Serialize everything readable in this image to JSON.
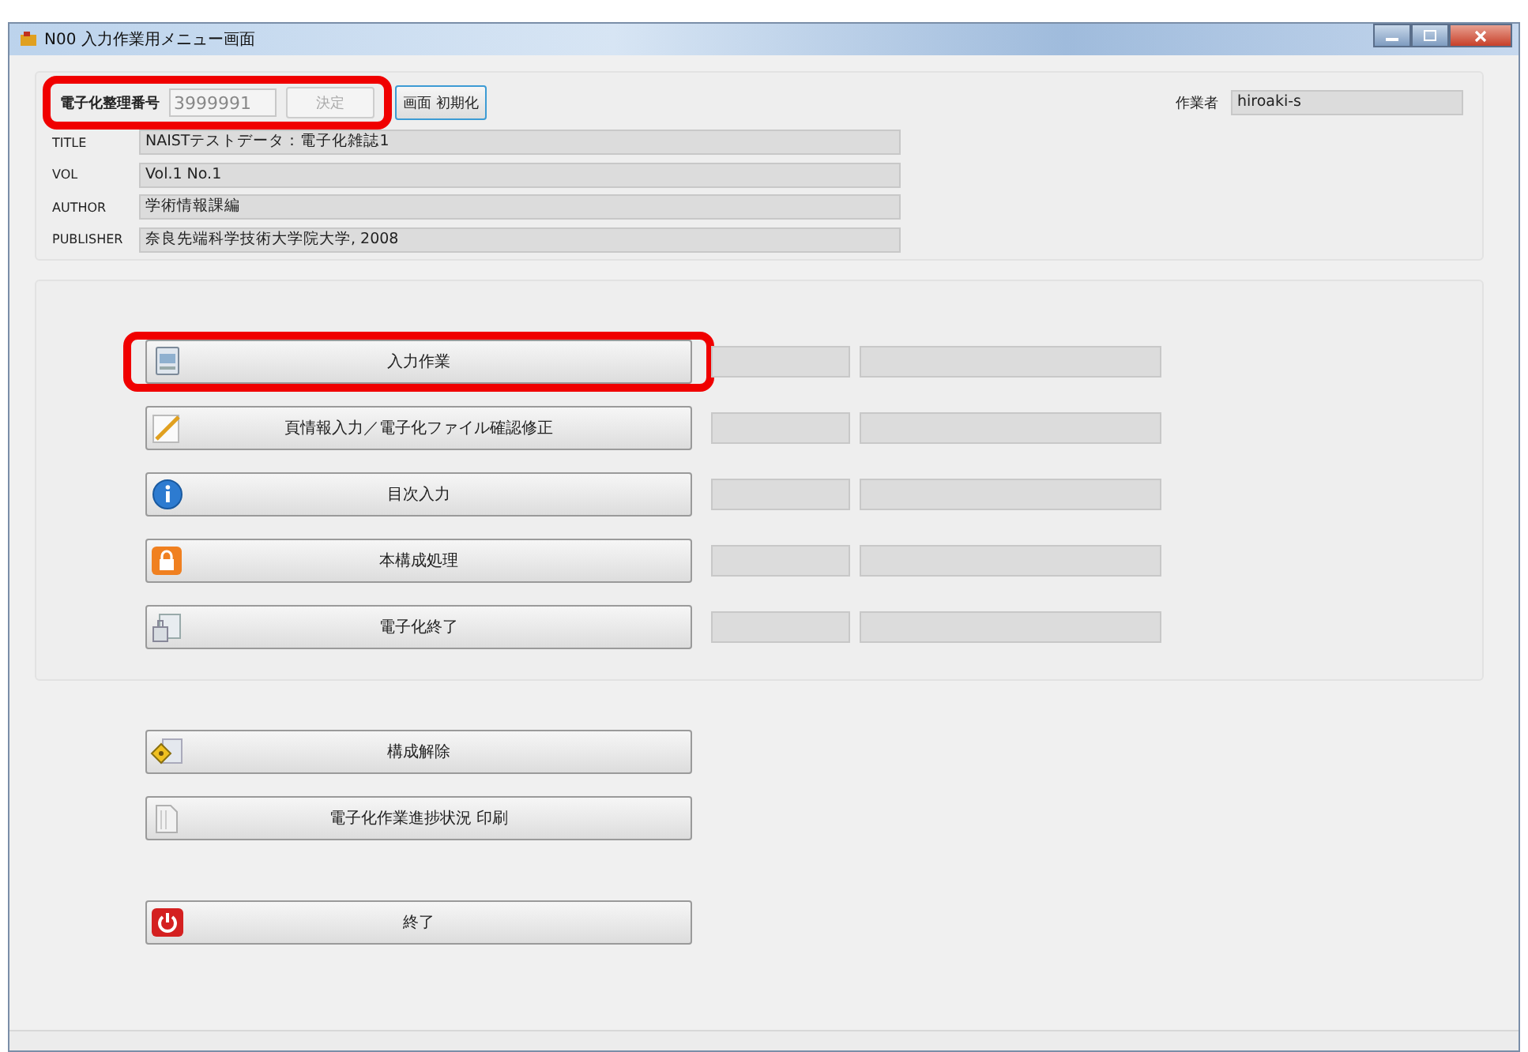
{
  "window": {
    "title": "N00 入力作業用メニュー画面"
  },
  "record": {
    "label": "電子化整理番号",
    "value": "3999991",
    "confirm": "決定",
    "confirm_disabled": true,
    "highlighted": true
  },
  "reset_button": "画面 初期化",
  "worker": {
    "label": "作業者",
    "value": "hiroaki-s"
  },
  "fields": [
    {
      "label": "TITLE",
      "value": "NAISTテストデータ：電子化雑誌1"
    },
    {
      "label": "VOL",
      "value": "Vol.1  No.1"
    },
    {
      "label": "AUTHOR",
      "value": "学術情報課編"
    },
    {
      "label": "PUBLISHER",
      "value": "奈良先端科学技術大学院大学, 2008"
    }
  ],
  "tasks": [
    {
      "label": "入力作業",
      "highlighted": true
    },
    {
      "label": "頁情報入力／電子化ファイル確認修正",
      "highlighted": false
    },
    {
      "label": "目次入力",
      "highlighted": false
    },
    {
      "label": "本構成処理",
      "highlighted": false
    },
    {
      "label": "電子化終了",
      "highlighted": false
    }
  ],
  "other_buttons": [
    {
      "label": "構成解除"
    },
    {
      "label": "電子化作業進捗状況  印刷"
    }
  ],
  "exit_button": {
    "label": "終了"
  }
}
